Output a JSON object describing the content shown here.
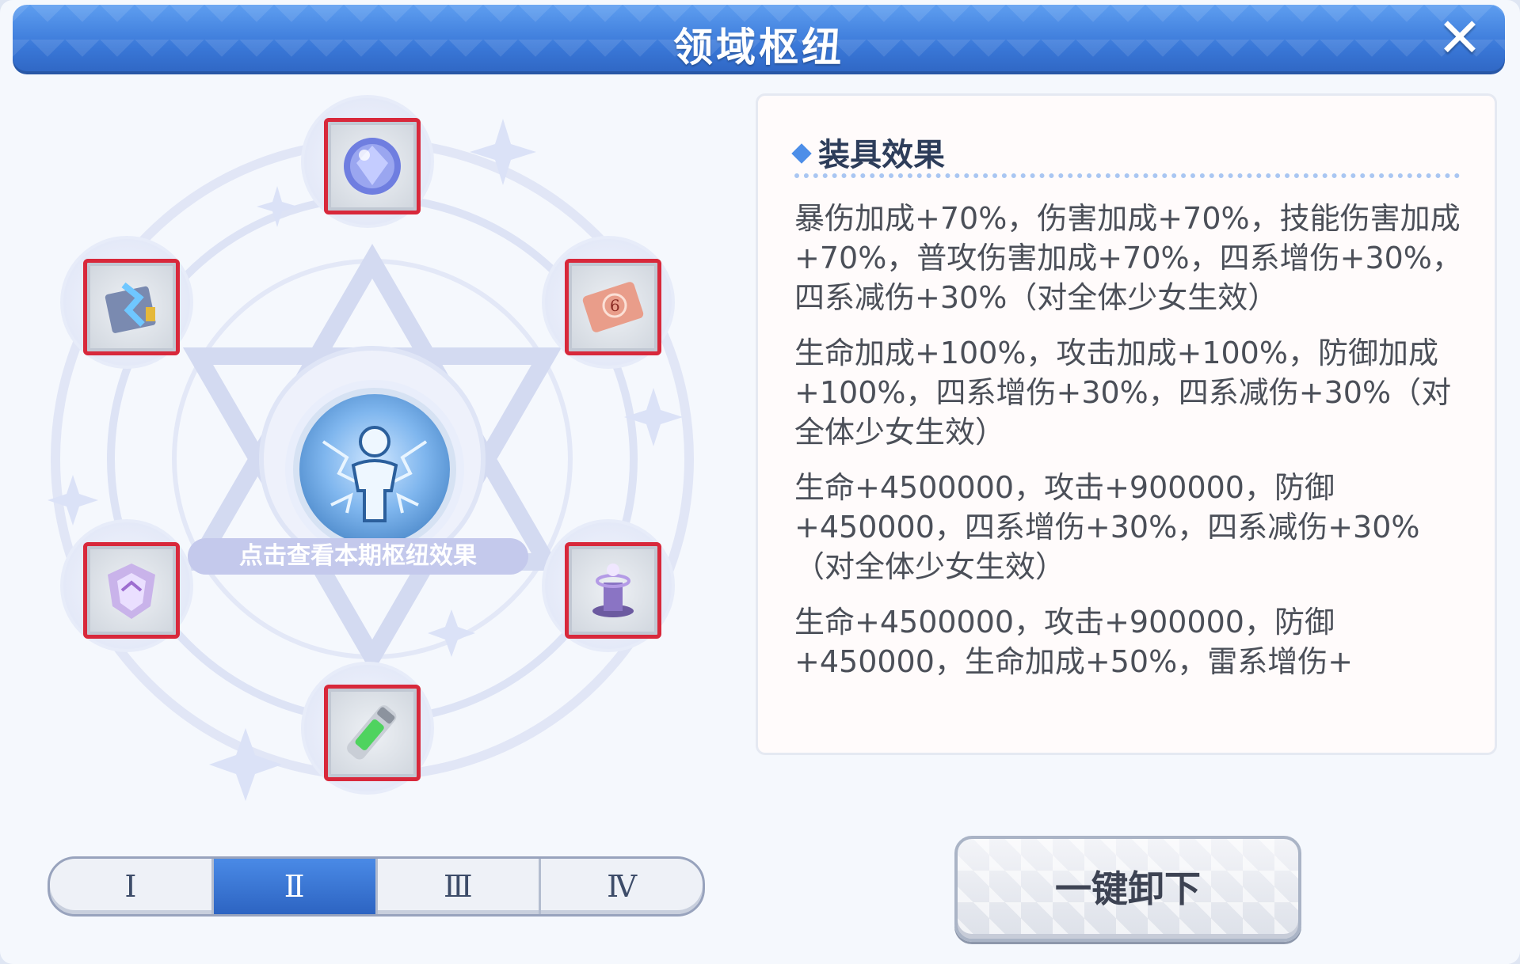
{
  "window": {
    "title": "领域枢纽"
  },
  "circle": {
    "hint": "点击查看本期枢纽效果"
  },
  "tabs": [
    "Ⅰ",
    "Ⅱ",
    "Ⅲ",
    "Ⅳ"
  ],
  "active_tab": "Ⅱ",
  "panel": {
    "heading": "装具效果",
    "effects": [
      "暴伤加成+70%，伤害加成+70%，技能伤害加成+70%，普攻伤害加成+70%，四系增伤+30%，四系减伤+30%（对全体少女生效）",
      "生命加成+100%，攻击加成+100%，防御加成+100%，四系增伤+30%，四系减伤+30%（对全体少女生效）",
      "生命+4500000，攻击+900000，防御+450000，四系增伤+30%，四系减伤+30%（对全体少女生效）",
      "生命+4500000，攻击+900000，防御+450000，生命加成+50%，雷系增伤+"
    ]
  },
  "unload_button": "一键卸下",
  "colors": {
    "accent": "#3a78d8",
    "slot_border": "#d8283b"
  }
}
